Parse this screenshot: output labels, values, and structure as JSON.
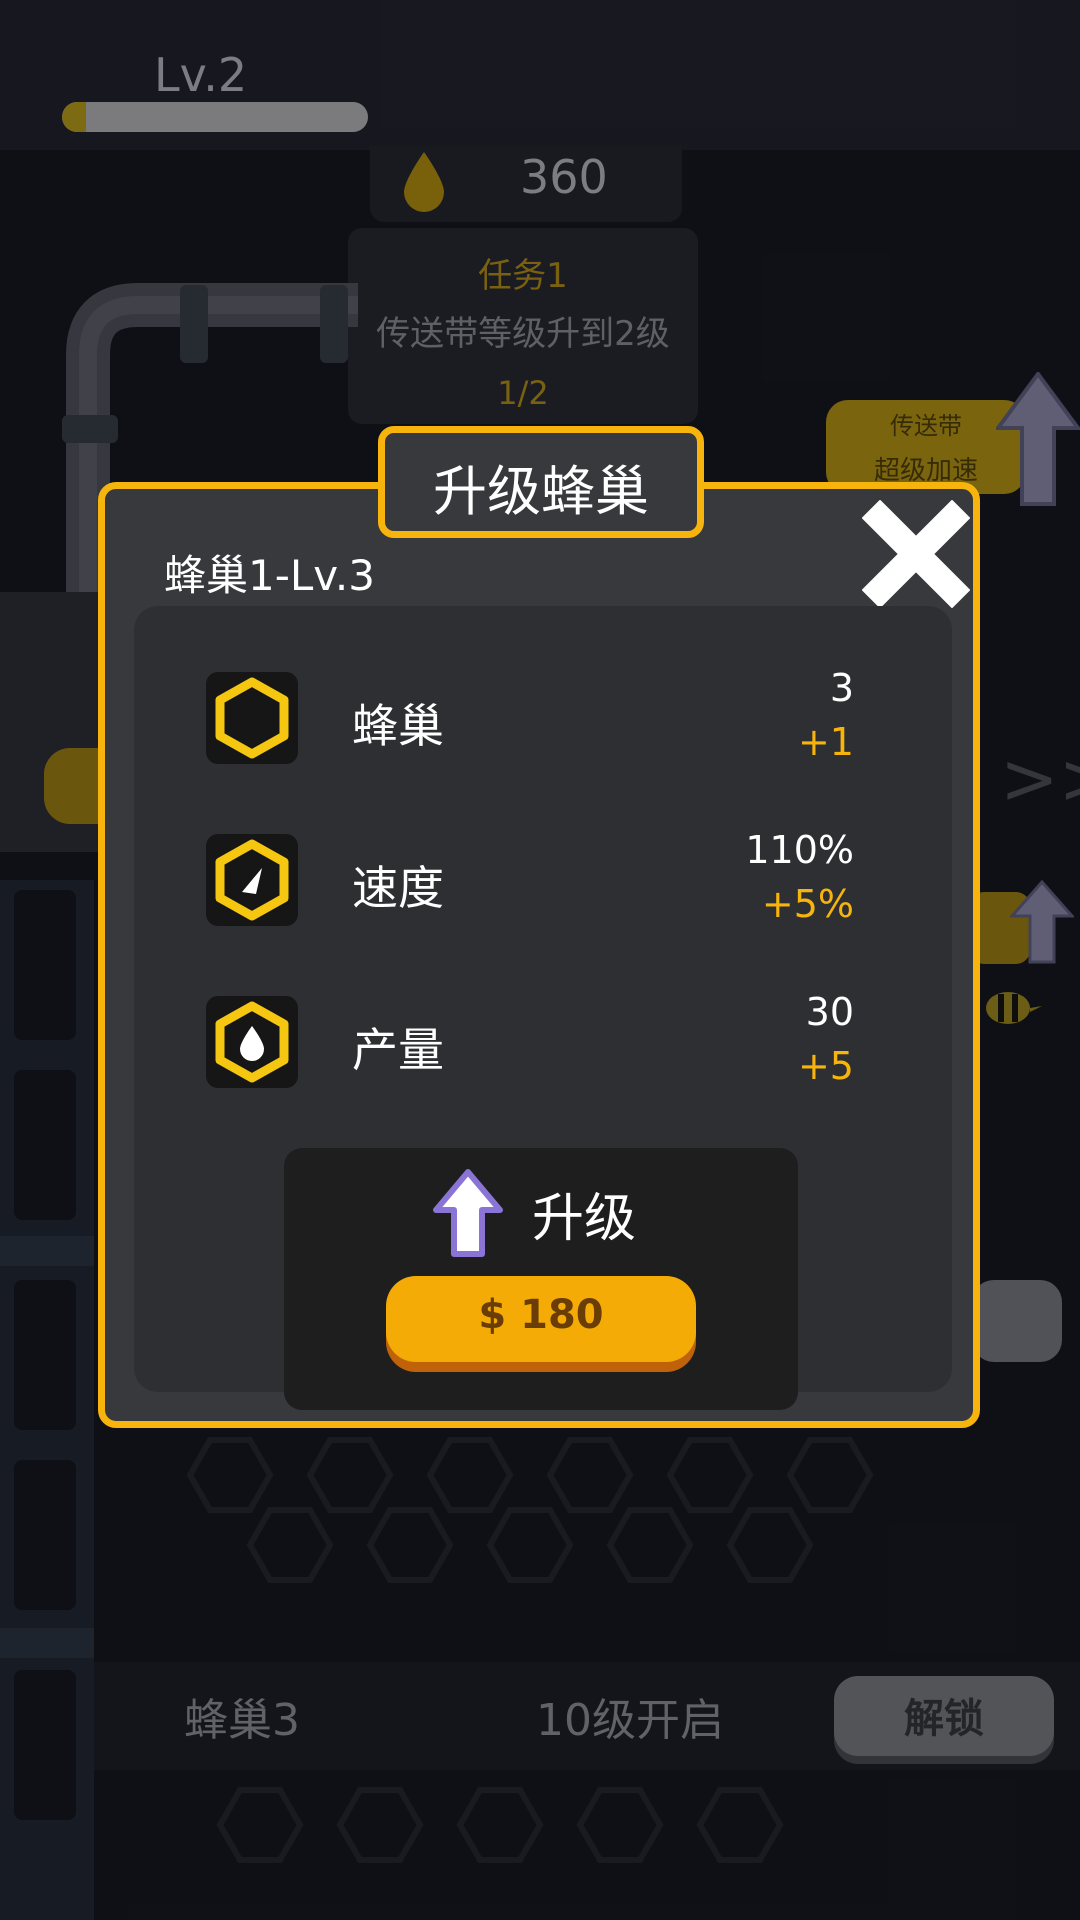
{
  "player": {
    "level_label": "Lv.2",
    "xp_progress": 0.08
  },
  "resources": {
    "honey_count": "360",
    "honey_icon": "honey-drop-icon"
  },
  "task": {
    "title": "任务1",
    "description": "传送带等级升到2级",
    "progress": "1/2"
  },
  "conveyor": {
    "boost_line1": "传送带",
    "boost_line2": "超级加速"
  },
  "hive3": {
    "name": "蜂巢3",
    "requirement": "10级开启",
    "unlock_label": "解锁"
  },
  "modal": {
    "title": "升级蜂巢",
    "hive_level": "蜂巢1-Lv.3",
    "close_icon": "close-x-icon",
    "stats": [
      {
        "label": "蜂巢",
        "value": "3",
        "delta": "+1",
        "icon": "hexagon-icon"
      },
      {
        "label": "速度",
        "value": "110%",
        "delta": "+5%",
        "icon": "speed-gauge-icon"
      },
      {
        "label": "产量",
        "value": "30",
        "delta": "+5",
        "icon": "honey-drop-icon"
      }
    ],
    "upgrade": {
      "label": "升级",
      "price": "$ 180",
      "icon": "up-arrow-icon"
    }
  },
  "colors": {
    "accent": "#f6b40c",
    "modal_bg": "#38393d",
    "panel_bg": "#2e2f33",
    "price_button": "#f5ab05"
  }
}
